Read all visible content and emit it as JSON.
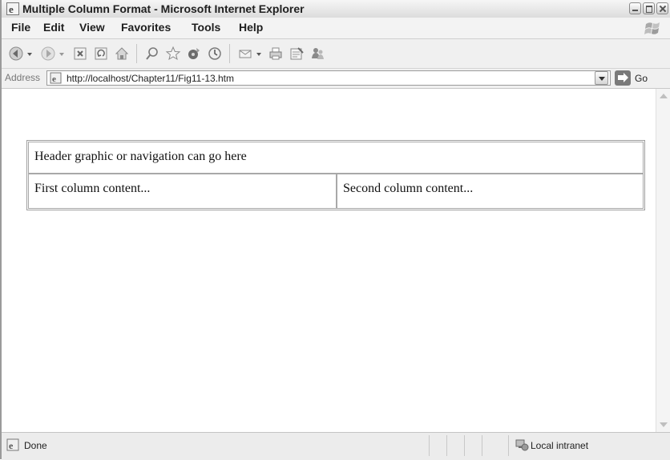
{
  "window": {
    "title": "Multiple Column Format - Microsoft Internet Explorer"
  },
  "menu": {
    "items": [
      "File",
      "Edit",
      "View",
      "Favorites",
      "Tools",
      "Help"
    ]
  },
  "toolbar": {
    "icons": [
      "back-icon",
      "forward-icon",
      "stop-icon",
      "refresh-icon",
      "home-icon",
      "search-icon",
      "favorites-icon",
      "media-icon",
      "history-icon",
      "mail-icon",
      "print-icon",
      "edit-icon",
      "messenger-icon"
    ]
  },
  "address": {
    "label": "Address",
    "url": "http://localhost/Chapter11/Fig11-13.htm",
    "go_label": "Go"
  },
  "page": {
    "header_cell": "Header graphic or navigation can go here",
    "first_column": "First column content...",
    "second_column": "Second column content..."
  },
  "status": {
    "text": "Done",
    "zone": "Local intranet"
  }
}
